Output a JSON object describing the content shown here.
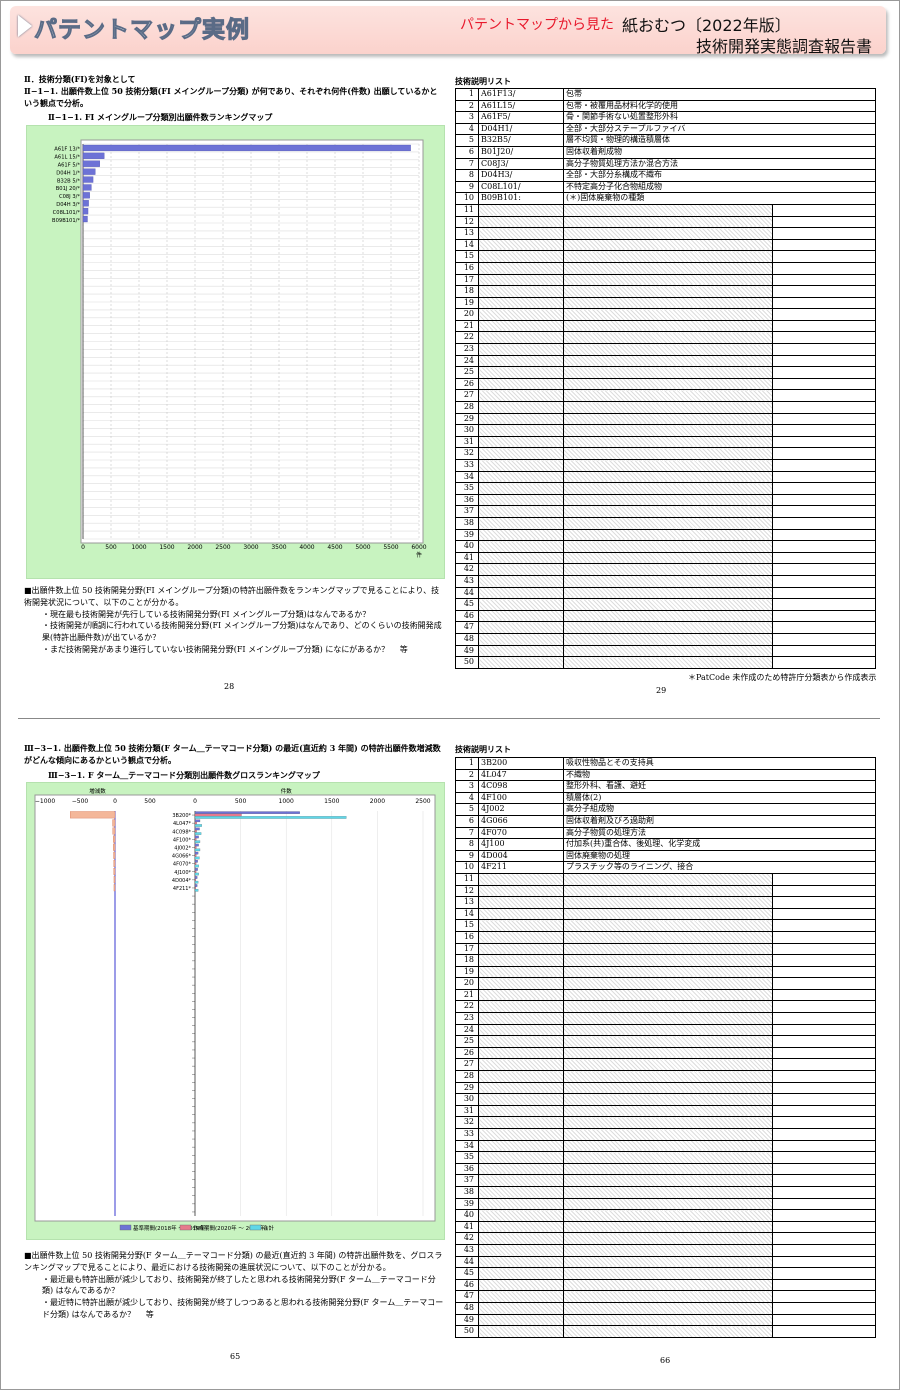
{
  "header": {
    "title": "パテントマップ実例",
    "subtitle": "パテントマップから見た",
    "product": "紙おむつ〔2022年版〕",
    "report": "技術開発実態調査報告書"
  },
  "top_left": {
    "section": "Ⅱ．技術分類(FI)を対象として",
    "heading": "Ⅱ−1−1. 出願件数上位 50 技術分類(FI メイングループ分類) が何であり、それぞれ何件(件数) 出願しているかという観点で分析。",
    "chart_title": "Ⅱ−1−1. FI メイングループ分類別出願件数ランキングマップ",
    "unit": "件",
    "bullets": [
      "■出願件数上位 50 技術開発分野(FI メイングループ分類)の特許出願件数をランキングマップで見ることにより、技術開発状況について、以下のことが分かる。",
      "・現在最も技術開発が先行している技術開発分野(FI メイングループ分類)はなんであるか？",
      "・技術開発が順調に行われている技術開発分野(FI メイングループ分類)はなんであり、どのくらいの技術開発成果(特許出願件数)が出ているか？",
      "・まだ技術開発があまり進行していない技術開発分野(FI メイングループ分類) になにがあるか？　 等"
    ],
    "page": "28"
  },
  "top_right": {
    "list_title": "技術説明リスト",
    "footnote": "＊PatCode 未作成のため特許庁分類表から作成表示",
    "page": "29",
    "rows": [
      [
        "1",
        "A61F13/",
        "包帯"
      ],
      [
        "2",
        "A61L15/",
        "包帯・被覆用品材料化学的使用"
      ],
      [
        "3",
        "A61F5/",
        "骨・関節手術ない処置整形外科"
      ],
      [
        "4",
        "D04H1/",
        "全部・大部分ステープルファイバ"
      ],
      [
        "5",
        "B32B5/",
        "層不均質・物理的構造積層体"
      ],
      [
        "6",
        "B01J20/",
        "固体収着剤成物"
      ],
      [
        "7",
        "C08J3/",
        "高分子物質処理方法か混合方法"
      ],
      [
        "8",
        "D04H3/",
        "全部・大部分糸構成不織布"
      ],
      [
        "9",
        "C08L101/",
        "不特定高分子化合物組成物"
      ],
      [
        "10",
        "B09B101:",
        "(＊)固体廃棄物の種類"
      ]
    ]
  },
  "bottom_left": {
    "heading": "Ⅲ−3−1. 出願件数上位 50 技術分類(F ターム＿テーマコード分類) の最近(直近約 3 年間) の特許出願件数増減数がどんな傾向にあるかという観点で分析。",
    "chart_title": "Ⅲ−3−1. F ターム＿テーマコード分類別出願件数グロスランキングマップ",
    "left_axis_title": "増減数",
    "right_axis_title": "件数",
    "legend": [
      "基準期間(2018年 ～ 2019年)",
      "作成期間(2020年 ～ 2022年)",
      "合計"
    ],
    "bullets": [
      "■出願件数上位 50 技術開発分野(F ターム＿テーマコード分類) の最近(直近約 3 年間) の特許出願件数を、グロスランキングマップで見ることにより、最近における技術開発の進展状況について、以下のことが分かる。",
      "・最近最も特許出願が減少しており、技術開発が終了したと思われる技術開発分野(F ターム＿テーマコード分類) はなんであるか？",
      "・最近特に特許出願が減少しており、技術開発が終了しつつあると思われる技術開発分野(F ターム＿テーマコード分類) はなんであるか？　 等"
    ],
    "page": "65"
  },
  "bottom_right": {
    "list_title": "技術説明リスト",
    "page": "66",
    "rows": [
      [
        "1",
        "3B200",
        "吸収性物品とその支持具"
      ],
      [
        "2",
        "4L047",
        "不織物"
      ],
      [
        "3",
        "4C098",
        "整形外科、看護、避妊"
      ],
      [
        "4",
        "4F100",
        "積層体(2)"
      ],
      [
        "5",
        "4J002",
        "高分子組成物"
      ],
      [
        "6",
        "4G066",
        "固体収着剤及びろ過助剤"
      ],
      [
        "7",
        "4F070",
        "高分子物質の処理方法"
      ],
      [
        "8",
        "4J100",
        "付加系(共)重合体、後処理、化学変成"
      ],
      [
        "9",
        "4D004",
        "固体廃棄物の処理"
      ],
      [
        "10",
        "4F211",
        "プラスチック等のライニング、接合"
      ]
    ]
  },
  "chart_data": [
    {
      "type": "bar",
      "title": "Ⅱ−1−1. FI メイングループ分類別出願件数ランキングマップ",
      "categories": [
        "A61F 13/*",
        "A61L 15/*",
        "A61F 5/*",
        "D04H 1/*",
        "B32B 5/*",
        "B01J 20/*",
        "C08J 3/*",
        "D04H 3/*",
        "C08L101/*",
        "B09B101/*"
      ],
      "values": [
        5850,
        380,
        300,
        220,
        180,
        150,
        120,
        100,
        90,
        80
      ],
      "xlim": [
        0,
        6000
      ],
      "xticks": [
        0,
        500,
        1000,
        1500,
        2000,
        2500,
        3000,
        3500,
        4000,
        4500,
        5000,
        5500,
        6000
      ],
      "xlabel": "件",
      "orientation": "horizontal",
      "color": "#6d72d6"
    },
    {
      "type": "bar",
      "title": "Ⅲ−3−1. F ターム＿テーマコード分類別出願件数グロスランキングマップ",
      "categories": [
        "3B200",
        "4L047",
        "4C098",
        "4F100",
        "4J002",
        "4G066",
        "4F070",
        "4J100",
        "4D004",
        "4F211"
      ],
      "left_xlim": [
        -1000,
        500
      ],
      "left_xticks": [
        -1000,
        -500,
        0,
        500
      ],
      "right_xlim": [
        0,
        2500
      ],
      "right_xticks": [
        0,
        500,
        1000,
        1500,
        2000,
        2500
      ],
      "series": [
        {
          "name": "基準期間(2018年 ～ 2019年)",
          "values": [
            1150,
            55,
            50,
            40,
            40,
            35,
            30,
            30,
            25,
            25
          ],
          "color": "#6d72d6"
        },
        {
          "name": "作成期間(2020年 ～ 2022年)",
          "values": [
            510,
            20,
            18,
            15,
            15,
            14,
            12,
            12,
            10,
            10
          ],
          "color": "#e67a8c"
        },
        {
          "name": "合計",
          "values": [
            1660,
            75,
            68,
            55,
            55,
            49,
            42,
            42,
            35,
            35
          ],
          "color": "#5fd7e8"
        }
      ],
      "change": [
        -640,
        -35,
        -32,
        -25,
        -25,
        -21,
        -18,
        -18,
        -15,
        -15
      ]
    }
  ]
}
